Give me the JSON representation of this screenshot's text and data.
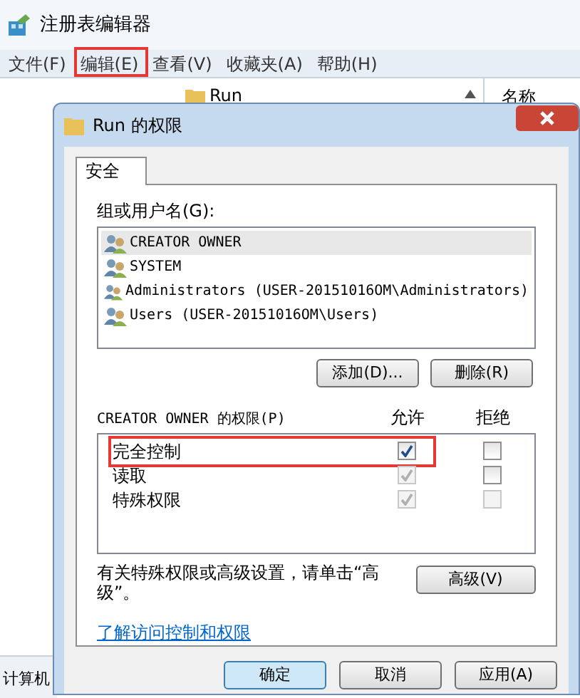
{
  "window": {
    "title": "注册表编辑器"
  },
  "menu": [
    {
      "label": "文件(F)"
    },
    {
      "label": "编辑(E)",
      "annotated": true
    },
    {
      "label": "查看(V)"
    },
    {
      "label": "收藏夹(A)"
    },
    {
      "label": "帮助(H)"
    }
  ],
  "tree": {
    "item": "Run"
  },
  "right_pane": {
    "column": "名称"
  },
  "status_bar": "计算机",
  "dialog": {
    "title": "Run 的权限",
    "tabs": [
      {
        "label": "安全",
        "selected": true
      }
    ],
    "groups_label": "组或用户名(G):",
    "groups": [
      {
        "name": "CREATOR OWNER",
        "selected": true
      },
      {
        "name": "SYSTEM",
        "selected": false
      },
      {
        "name": "Administrators (USER-20151016OM\\Administrators)",
        "selected": false
      },
      {
        "name": "Users (USER-20151016OM\\Users)",
        "selected": false
      }
    ],
    "group_buttons": [
      "添加(D)...",
      "删除(R)"
    ],
    "permissions_label": "CREATOR OWNER 的权限(P)",
    "allow_header": "允许",
    "deny_header": "拒绝",
    "permissions": [
      {
        "name": "完全控制",
        "annotated": true,
        "allow": {
          "checked": true,
          "disabled": false
        },
        "deny": {
          "checked": false,
          "disabled": false
        }
      },
      {
        "name": "读取",
        "annotated": false,
        "allow": {
          "checked": true,
          "disabled": true
        },
        "deny": {
          "checked": false,
          "disabled": false
        }
      },
      {
        "name": "特殊权限",
        "annotated": false,
        "allow": {
          "checked": true,
          "disabled": true
        },
        "deny": {
          "checked": false,
          "disabled": true
        }
      }
    ],
    "advanced_text": "有关特殊权限或高级设置，请单击“高级”。",
    "advanced_button": "高级(V)",
    "link": "了解访问控制和权限",
    "buttons": [
      {
        "label": "确定",
        "default": true
      },
      {
        "label": "取消",
        "default": false
      },
      {
        "label": "应用(A)",
        "default": false
      }
    ]
  }
}
